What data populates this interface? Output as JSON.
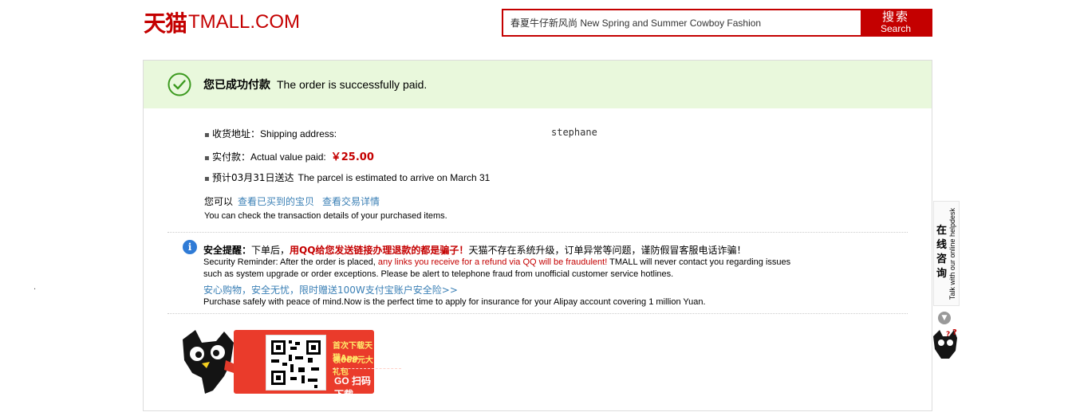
{
  "header": {
    "logo_cn": "天猫",
    "logo_en": "TMALL.COM",
    "search_value": "春夏牛仔新风尚 New Spring and Summer Cowboy Fashion",
    "search_btn_cn": "搜索",
    "search_btn_en": "Search"
  },
  "banner": {
    "title_cn": "您已成功付款",
    "title_en": "The order is successfully paid."
  },
  "order": {
    "address_label_cn": "收货地址：",
    "address_label_en": "Shipping address:",
    "recipient": "stephane",
    "paid_label_cn": "实付款：",
    "paid_label_en": "Actual value paid:",
    "paid_value": "￥25.00",
    "eta_cn": "预计03月31日送达",
    "eta_en": "The parcel is estimated to arrive on March 31",
    "you_can": "您可以",
    "link_purchased": "查看已买到的宝贝",
    "link_details": "查看交易详情",
    "check_details_en": "You can check the transaction details of your purchased items."
  },
  "security": {
    "title_cn": "安全提醒：",
    "text_cn_1": "下单后，",
    "warning_cn": "用QQ给您发送链接办理退款的都是骗子！",
    "text_cn_2": "天猫不存在系统升级，订单异常等问题，谨防假冒客服电话诈骗！",
    "text_en_1": "Security Reminder: After the order is placed, ",
    "warning_en": "any links you receive for a refund via QQ will be fraudulent!",
    "text_en_2": " TMALL will never contact you regarding issues",
    "text_en_3": "such as system upgrade or order exceptions. Please be alert to telephone fraud from unofficial customer service hotlines.",
    "insurance_link_cn": "安心购物，安全无忧，限时赠送100W支付宝账户安全险>>",
    "insurance_en": "Purchase safely with peace of mind.Now is the perfect time to apply for insurance for your Alipay account covering 1 million Yuan."
  },
  "promo": {
    "line1": "首次下载天猫App",
    "line2": "领668元大礼包",
    "go": "GO 扫码下载"
  },
  "helpdesk": {
    "label_cn": "在线咨询",
    "label_en": "Talk with our online helpdesk"
  },
  "colors": {
    "brand_red": "#c40000",
    "banner_green": "#e9f8dc",
    "link_blue": "#3a7fb5"
  }
}
